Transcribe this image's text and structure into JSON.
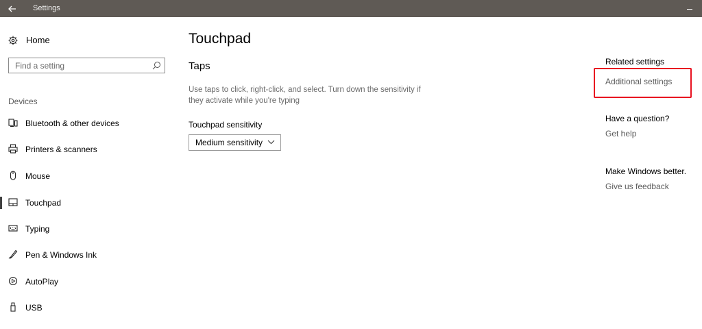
{
  "window": {
    "title": "Settings"
  },
  "sidebar": {
    "home_label": "Home",
    "search_placeholder": "Find a setting",
    "group_label": "Devices",
    "items": [
      {
        "label": "Bluetooth & other devices",
        "icon": "bluetooth-devices-icon"
      },
      {
        "label": "Printers & scanners",
        "icon": "printer-icon"
      },
      {
        "label": "Mouse",
        "icon": "mouse-icon"
      },
      {
        "label": "Touchpad",
        "icon": "touchpad-icon",
        "active": true
      },
      {
        "label": "Typing",
        "icon": "keyboard-icon"
      },
      {
        "label": "Pen & Windows Ink",
        "icon": "pen-icon"
      },
      {
        "label": "AutoPlay",
        "icon": "autoplay-icon"
      },
      {
        "label": "USB",
        "icon": "usb-icon"
      }
    ]
  },
  "main": {
    "title": "Touchpad",
    "section_title": "Taps",
    "description": "Use taps to click, right-click, and select. Turn down the sensitivity if they activate while you're typing",
    "sensitivity_label": "Touchpad sensitivity",
    "sensitivity_value": "Medium sensitivity"
  },
  "related": {
    "heading": "Related settings",
    "additional_link": "Additional settings",
    "question_heading": "Have a question?",
    "help_link": "Get help",
    "better_heading": "Make Windows better.",
    "feedback_link": "Give us feedback"
  },
  "colors": {
    "titlebar": "#5f5a55",
    "highlight": "#e81020",
    "active_indicator": "#404040"
  }
}
